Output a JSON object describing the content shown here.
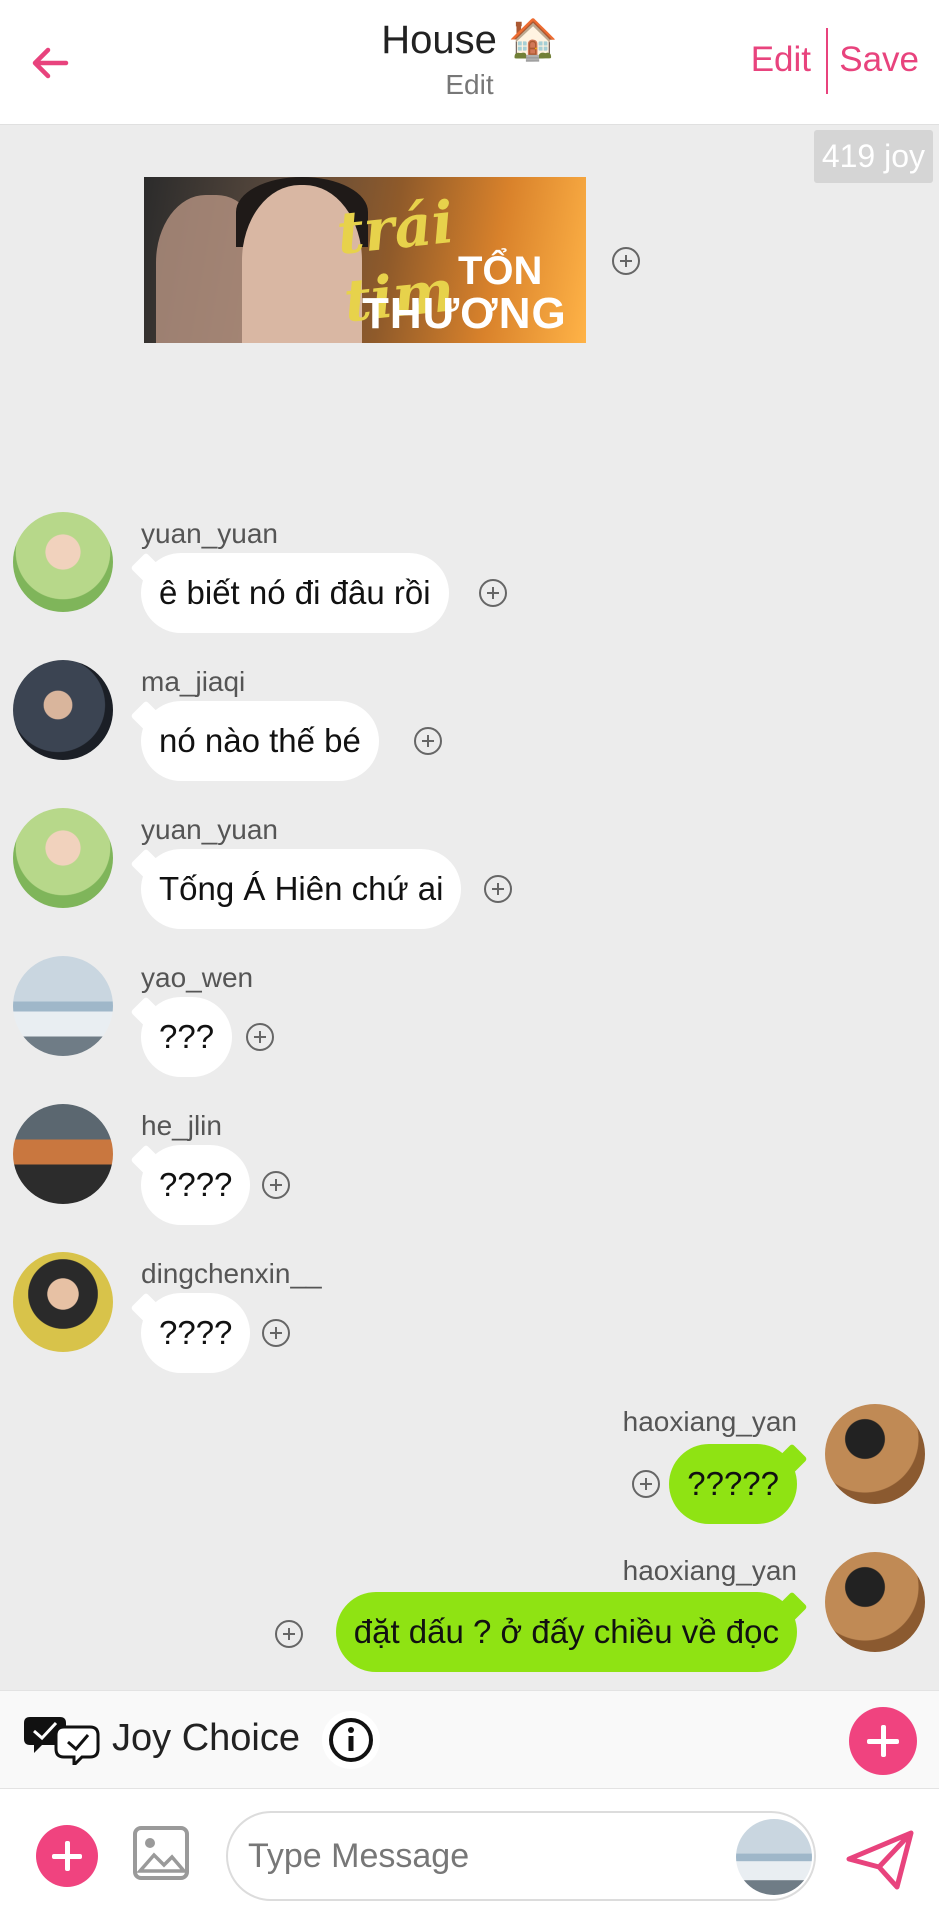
{
  "header": {
    "title": "House",
    "title_emoji": "🏠",
    "subtitle": "Edit",
    "edit_label": "Edit",
    "save_label": "Save",
    "accent_color": "#e8437d"
  },
  "joy_badge": "419 joy",
  "banner": {
    "line1": "trái tim",
    "line2": "TỔN",
    "line3": "THƯƠNG"
  },
  "messages": [
    {
      "user": "yuan_yuan",
      "text": "ê biết nó đi đâu rồi",
      "side": "left"
    },
    {
      "user": "ma_jiaqi",
      "text": "nó nào thế bé",
      "side": "left"
    },
    {
      "user": "yuan_yuan",
      "text": "Tống Á Hiên chứ ai",
      "side": "left"
    },
    {
      "user": "yao_wen",
      "text": "???",
      "side": "left"
    },
    {
      "user": "he_jlin",
      "text": "????",
      "side": "left"
    },
    {
      "user": "dingchenxin__",
      "text": "????",
      "side": "left"
    },
    {
      "user": "haoxiang_yan",
      "text": "?????",
      "side": "right"
    },
    {
      "user": "haoxiang_yan",
      "text": "đặt dấu ? ở đấy chiều về đọc",
      "side": "right"
    }
  ],
  "joy_bar": {
    "label": "Joy Choice",
    "icon": "chat-check-icon",
    "info_icon": "info-icon",
    "add_icon": "plus-icon"
  },
  "input_bar": {
    "placeholder": "Type Message",
    "add_icon": "plus-icon",
    "image_icon": "image-icon",
    "send_icon": "send-icon"
  },
  "colors": {
    "accent": "#e8437d",
    "outgoing_bubble": "#8fe313",
    "incoming_bubble": "#ffffff",
    "background": "#ececec"
  }
}
